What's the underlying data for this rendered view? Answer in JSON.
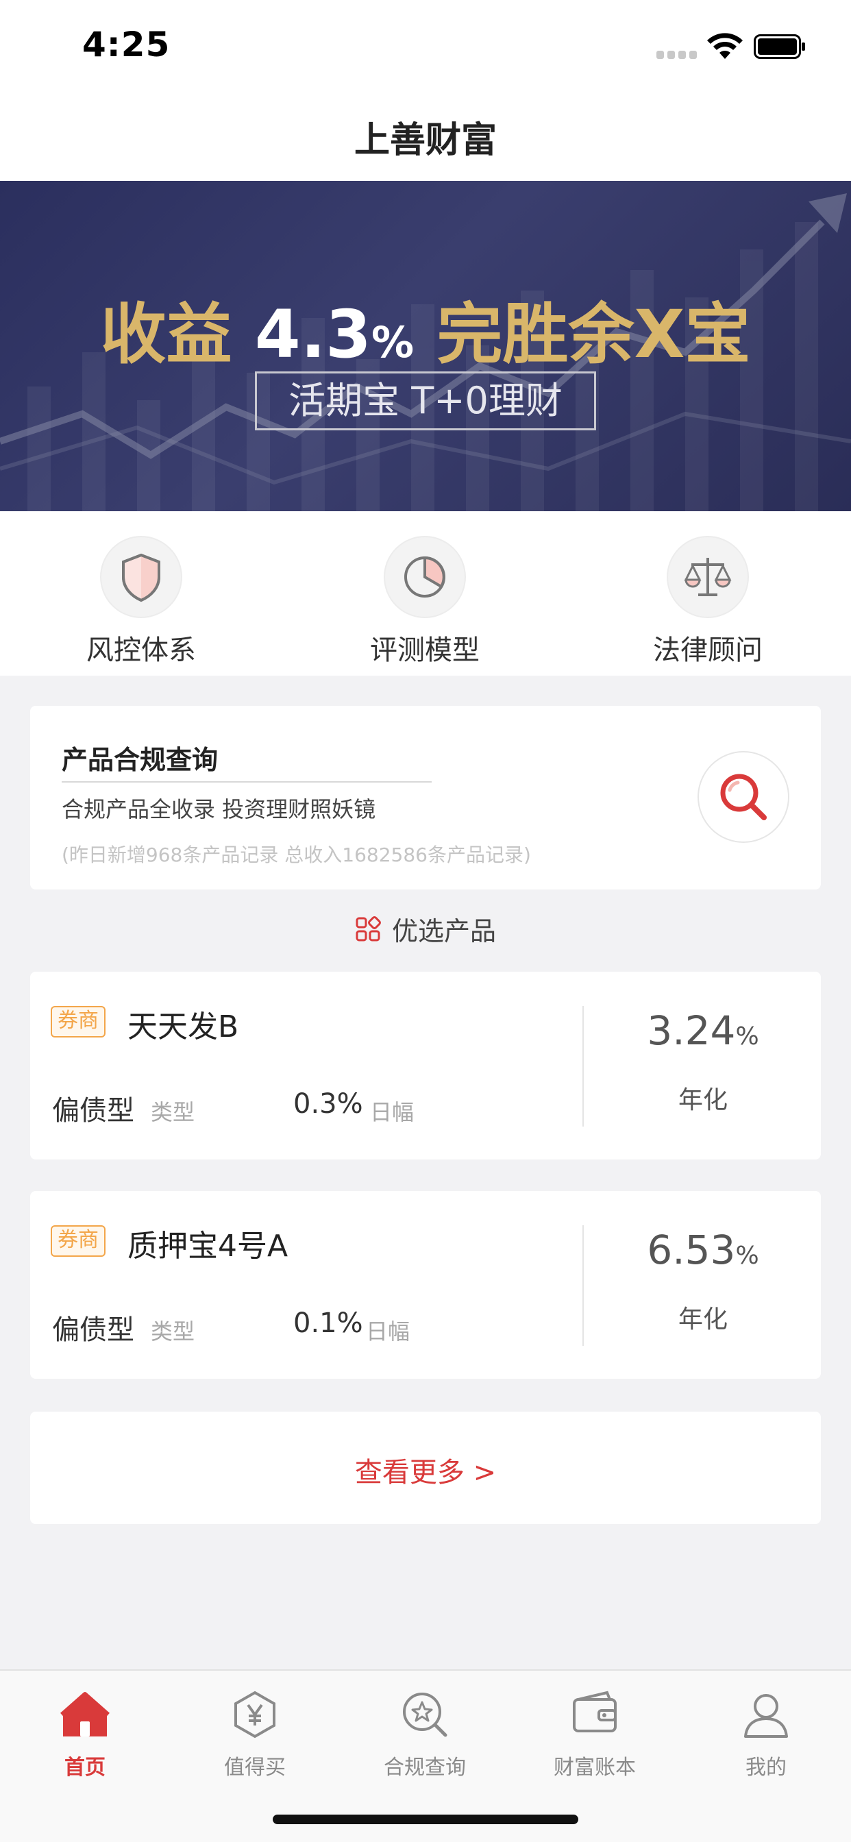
{
  "status_bar": {
    "time": "4:25"
  },
  "nav": {
    "title": "上善财富"
  },
  "banner": {
    "headline_part1": "收益 ",
    "headline_rate": "4.3",
    "headline_pct": "%",
    "headline_part2": " 完胜余X宝",
    "subtitle": "活期宝 T+0理财"
  },
  "quick_entries": [
    {
      "label": "风控体系",
      "icon": "shield-icon"
    },
    {
      "label": "评测模型",
      "icon": "pie-chart-icon"
    },
    {
      "label": "法律顾问",
      "icon": "scale-icon"
    }
  ],
  "compliance": {
    "title": "产品合规查询",
    "subtitle": "合规产品全收录  投资理财照妖镜",
    "note": "(昨日新增968条产品记录  总收入1682586条产品记录)"
  },
  "section": {
    "title": "优选产品"
  },
  "products": [
    {
      "tag": "券商",
      "name": "天天发B",
      "type": "偏债型",
      "type_label": "类型",
      "daily": "0.3%",
      "daily_label": "日幅",
      "rate": "3.24",
      "rate_unit": "%",
      "rate_label": "年化"
    },
    {
      "tag": "券商",
      "name": "质押宝4号A",
      "type": "偏债型",
      "type_label": "类型",
      "daily": "0.1%",
      "daily_label": "日幅",
      "rate": "6.53",
      "rate_unit": "%",
      "rate_label": "年化"
    }
  ],
  "more": {
    "label": "查看更多 >"
  },
  "tabs": [
    {
      "label": "首页",
      "icon": "home-icon",
      "active": true
    },
    {
      "label": "值得买",
      "icon": "yen-hexagon-icon",
      "active": false
    },
    {
      "label": "合规查询",
      "icon": "search-star-icon",
      "active": false
    },
    {
      "label": "财富账本",
      "icon": "wallet-icon",
      "active": false
    },
    {
      "label": "我的",
      "icon": "user-icon",
      "active": false
    }
  ],
  "colors": {
    "accent": "#d93a3a",
    "tag": "#f3a64a",
    "banner_gold": "#d9b66a",
    "banner_bg": "#2b2f5e"
  }
}
